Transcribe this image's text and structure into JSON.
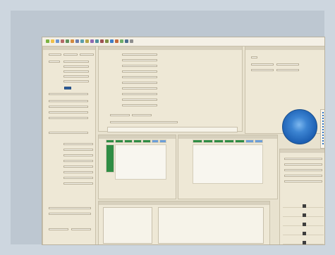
{
  "screen": {
    "toolbar_items": [
      "",
      "",
      "",
      "",
      "",
      "",
      "",
      "",
      "",
      "",
      "",
      "",
      "",
      "",
      "",
      "",
      "",
      "",
      ""
    ],
    "toolbar_right": "",
    "left_panel": {
      "labels": [
        "",
        "",
        "",
        "",
        "",
        "",
        "",
        "",
        "",
        "",
        "",
        "",
        "",
        "",
        "",
        "",
        "",
        ""
      ],
      "button_label": ""
    },
    "center_form": {
      "labels": [
        "",
        "",
        "",
        "",
        "",
        "",
        "",
        "",
        "",
        "",
        "",
        ""
      ],
      "tabs": [
        "",
        ""
      ]
    },
    "chart": {
      "title": "",
      "legend": [
        "",
        "",
        "",
        "",
        "",
        "",
        "",
        "",
        "",
        "",
        "",
        ""
      ]
    },
    "right_list": {
      "labels": [
        "",
        "",
        "",
        "",
        "",
        ""
      ]
    }
  }
}
